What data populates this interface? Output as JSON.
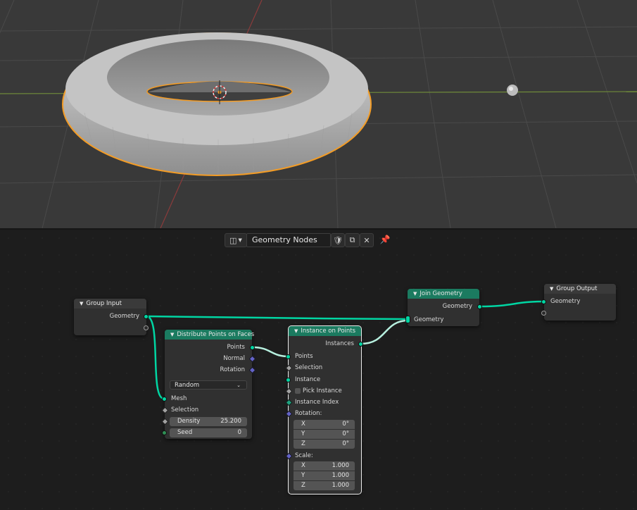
{
  "colors": {
    "geometry_socket": "#00d6a3",
    "vector_socket": "#6363c7",
    "node_header_geo": "#1b7b60",
    "selection_outline": "#f5a623"
  },
  "header": {
    "editor_type_icon": "node-editor-icon",
    "tree_name": "Geometry Nodes"
  },
  "nodes": {
    "group_input": {
      "title": "Group Input",
      "out_geometry": "Geometry"
    },
    "distribute": {
      "title": "Distribute Points on Faces",
      "out_points": "Points",
      "out_normal": "Normal",
      "out_rotation": "Rotation",
      "mode": "Random",
      "in_mesh": "Mesh",
      "in_selection": "Selection",
      "density_label": "Density",
      "density_value": "25.200",
      "seed_label": "Seed",
      "seed_value": "0"
    },
    "instance": {
      "title": "Instance on Points",
      "out_instances": "Instances",
      "in_points": "Points",
      "in_selection": "Selection",
      "in_instance": "Instance",
      "pick_instance": "Pick Instance",
      "instance_index": "Instance Index",
      "rotation_label": "Rotation:",
      "rot_x_label": "X",
      "rot_x": "0°",
      "rot_y_label": "Y",
      "rot_y": "0°",
      "rot_z_label": "Z",
      "rot_z": "0°",
      "scale_label": "Scale:",
      "scale_x_label": "X",
      "scale_x": "1.000",
      "scale_y_label": "Y",
      "scale_y": "1.000",
      "scale_z_label": "Z",
      "scale_z": "1.000"
    },
    "join": {
      "title": "Join Geometry",
      "out_geometry": "Geometry",
      "in_geometry": "Geometry"
    },
    "group_output": {
      "title": "Group Output",
      "in_geometry": "Geometry"
    }
  }
}
